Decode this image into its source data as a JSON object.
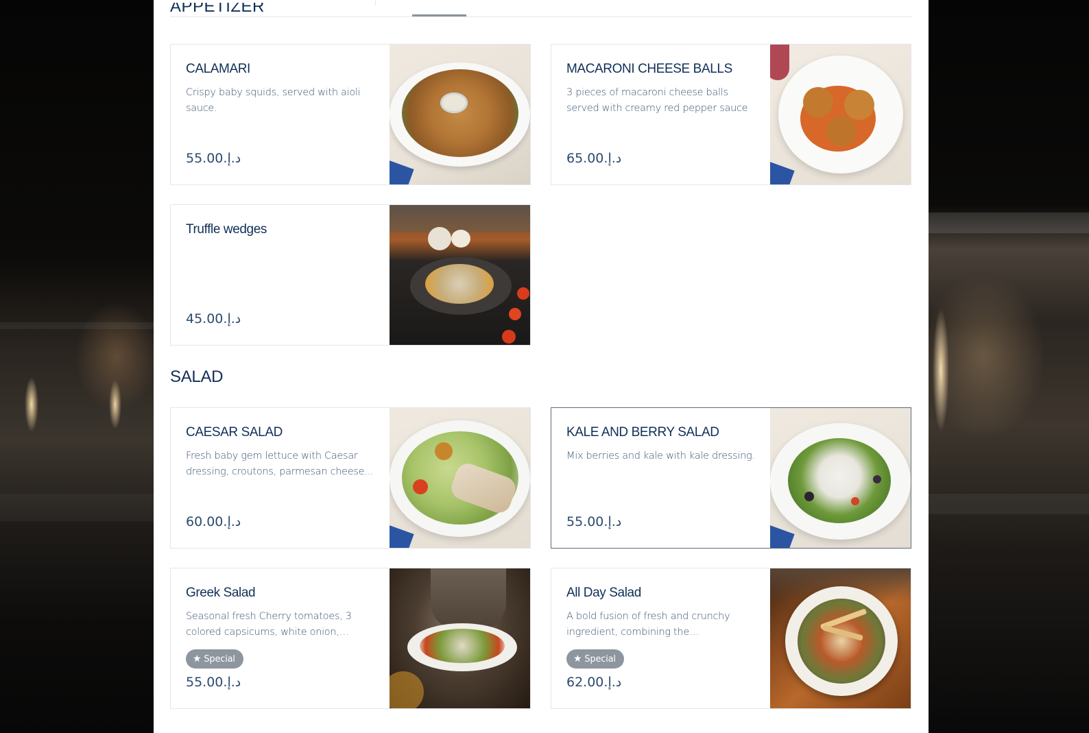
{
  "sections": [
    {
      "title": "APPETIZER"
    },
    {
      "title": "SALAD"
    }
  ],
  "currency": "د.إ.",
  "items": [
    {
      "name": "CALAMARI",
      "description": "Crispy baby squids, served with aioli sauce.",
      "price": "55.00",
      "image": "calamari-photo"
    },
    {
      "name": "MACARONI CHEESE BALLS",
      "description": "3 pieces of macaroni cheese balls served with creamy red pepper sauce",
      "price": "65.00",
      "image": "macaroni-cheese-balls-photo"
    },
    {
      "name": "Truffle wedges",
      "description": "",
      "price": "45.00",
      "image": "truffle-wedges-photo"
    },
    {
      "name": "CAESAR SALAD",
      "description": "Fresh baby gem lettuce with Caesar dressing, croutons, parmesan cheese...",
      "price": "60.00",
      "image": "caesar-salad-photo"
    },
    {
      "name": "KALE AND BERRY SALAD",
      "description": "Mix berries and kale with kale dressing.",
      "price": "55.00",
      "image": "kale-berry-salad-photo"
    },
    {
      "name": "Greek Salad",
      "description": "Seasonal fresh Cherry tomatoes, 3 colored capsicums, white onion, olives...",
      "badge": "Special",
      "price": "55.00",
      "image": "greek-salad-photo"
    },
    {
      "name": "All Day Salad",
      "description": "A bold fusion of fresh and crunchy ingredient, combining the Mediterrane...",
      "badge": "Special",
      "price": "62.00",
      "image": "all-day-salad-photo"
    }
  ],
  "icons": {
    "badge": "star-icon"
  },
  "colors": {
    "heading": "#0f2f57",
    "text": "#3b5573",
    "badge": "#8d969e"
  }
}
